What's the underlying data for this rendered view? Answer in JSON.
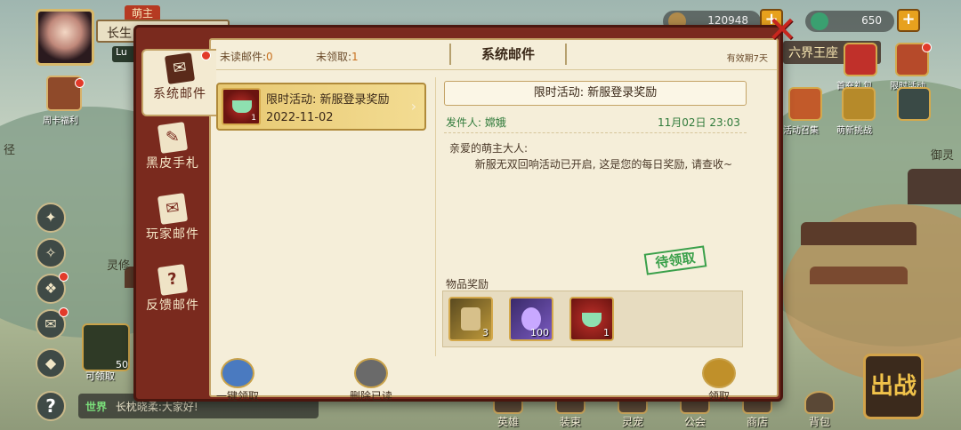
{
  "player": {
    "title_badge": "萌主",
    "name": "长生",
    "name2": "Lu"
  },
  "currency": {
    "copper": "120948",
    "jade": "650",
    "plus": "+"
  },
  "left_menu": {
    "week_card": "周卡福利",
    "claimable": "可领取",
    "claimable_count": "50",
    "help": "?"
  },
  "chat": {
    "channel": "世界",
    "message": "长枕晓柔:大家好!"
  },
  "right_events": {
    "title": "六界王座",
    "items": [
      "首充礼包",
      "限时活动",
      "活动召集",
      "萌新挑战"
    ]
  },
  "bottom_nav": [
    "英雄",
    "装束",
    "灵宠",
    "公会",
    "商店",
    "背包"
  ],
  "fight_label": "出战",
  "background_labels": [
    "径",
    "御灵",
    "灵修"
  ],
  "mail": {
    "tabs": [
      "系统邮件",
      "黑皮手札",
      "玩家邮件",
      "反馈邮件"
    ],
    "header": {
      "unread_label": "未读邮件:",
      "unread_count": "0",
      "unclaimed_label": "未领取:",
      "unclaimed_count": "1",
      "title": "系统邮件",
      "validity": "有效期7天"
    },
    "list": [
      {
        "title": "限时活动: 新服登录奖励",
        "date": "2022-11-02",
        "count": "1"
      }
    ],
    "detail": {
      "title": "限时活动: 新服登录奖励",
      "sender": "发件人: 嫦娥",
      "sent_at": "11月02日 23:03",
      "greeting": "亲爱的萌主大人:",
      "body": "新服无双回响活动已开启, 这是您的每日奖励, 请查收~",
      "stamp": "待领取",
      "rewards_label": "物品奖励",
      "rewards": [
        {
          "name": "scroll-item",
          "qty": "3"
        },
        {
          "name": "crystal-item",
          "qty": "100"
        },
        {
          "name": "cup-item",
          "qty": "1"
        }
      ]
    },
    "actions": {
      "claim_all": "一键领取",
      "delete_read": "删除已读",
      "claim": "领取"
    }
  }
}
